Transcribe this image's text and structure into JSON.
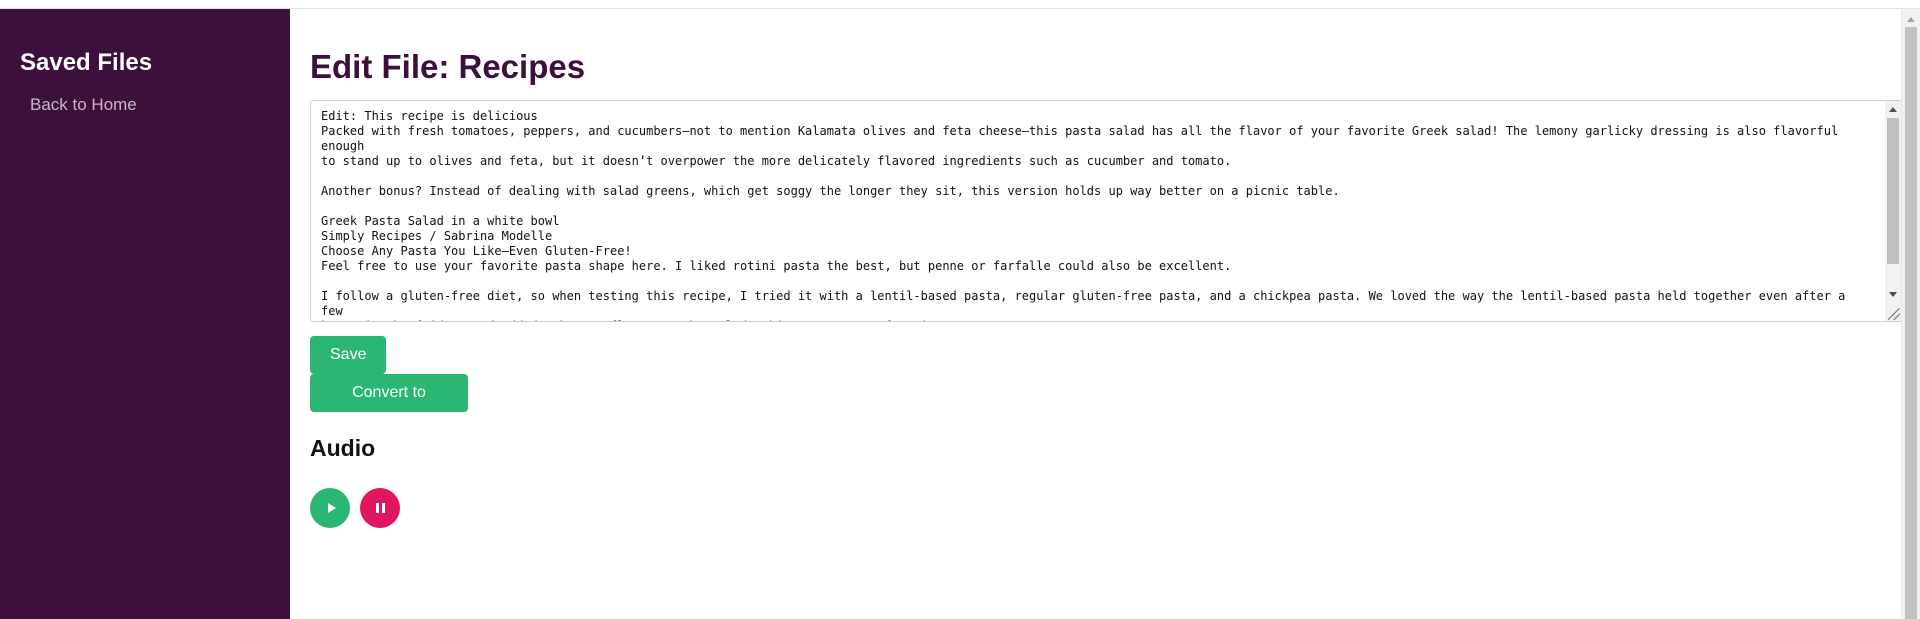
{
  "sidebar": {
    "title": "Saved Files",
    "back_link": "Back to Home"
  },
  "main": {
    "title": "Edit File: Recipes",
    "editor_content": "Edit: This recipe is delicious\nPacked with fresh tomatoes, peppers, and cucumbers—not to mention Kalamata olives and feta cheese—this pasta salad has all the flavor of your favorite Greek salad! The lemony garlicky dressing is also flavorful enough\nto stand up to olives and feta, but it doesn’t overpower the more delicately flavored ingredients such as cucumber and tomato.\n\nAnother bonus? Instead of dealing with salad greens, which get soggy the longer they sit, this version holds up way better on a picnic table.\n\nGreek Pasta Salad in a white bowl\nSimply Recipes / Sabrina Modelle\nChoose Any Pasta You Like—Even Gluten-Free!\nFeel free to use your favorite pasta shape here. I liked rotini pasta the best, but penne or farfalle could also be excellent.\n\nI follow a gluten-free diet, so when testing this recipe, I tried it with a lentil-based pasta, regular gluten-free pasta, and a chickpea pasta. We loved the way the lentil-based pasta held together even after a few\nhours in the fridge, and added a hearty flavor to the salad. This one was our favorite.",
    "save_label": "Save",
    "convert_label": "Convert to Audio",
    "audio_heading": "Audio"
  },
  "icons": {
    "play": "play-icon",
    "pause": "pause-icon"
  },
  "colors": {
    "sidebar_bg": "#3d0f3d",
    "title": "#3d0f3d",
    "accent_green": "#2bb673",
    "pause_red": "#e0175f"
  }
}
